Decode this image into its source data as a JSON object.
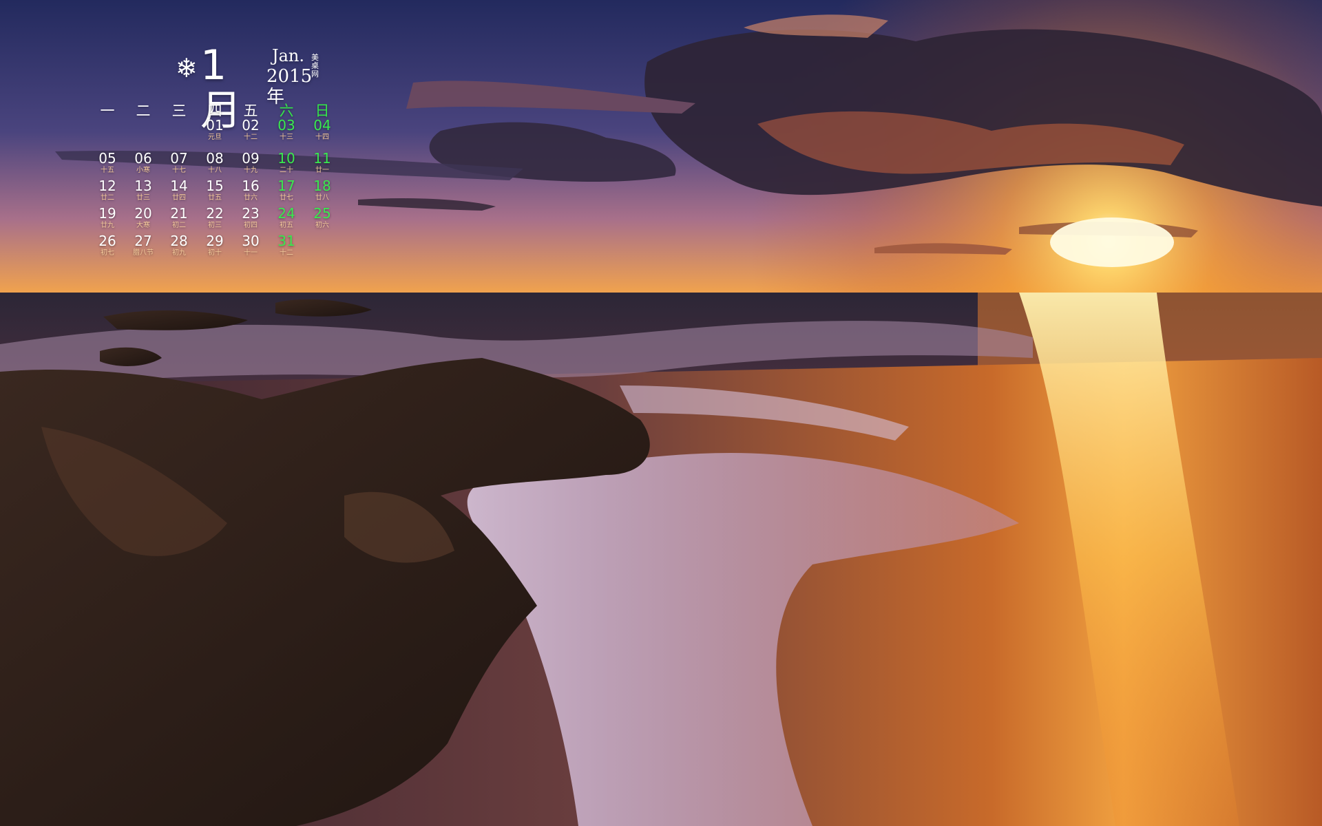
{
  "calendar": {
    "snowflake_icon": "snowflake-icon",
    "month_label": "1月",
    "month_en": "Jan.",
    "site_mark": "美桌网",
    "year_label": "2015年",
    "weekdays": [
      {
        "label": "一",
        "weekend": false
      },
      {
        "label": "二",
        "weekend": false
      },
      {
        "label": "三",
        "weekend": false
      },
      {
        "label": "四",
        "weekend": false
      },
      {
        "label": "五",
        "weekend": false
      },
      {
        "label": "六",
        "weekend": true
      },
      {
        "label": "日",
        "weekend": true
      }
    ],
    "weeks": [
      [
        null,
        null,
        null,
        {
          "num": "01",
          "lunar": "元旦"
        },
        {
          "num": "02",
          "lunar": "十二"
        },
        {
          "num": "03",
          "lunar": "十三",
          "weekend": true
        },
        {
          "num": "04",
          "lunar": "十四",
          "weekend": true
        }
      ],
      [
        {
          "num": "05",
          "lunar": "十五"
        },
        {
          "num": "06",
          "lunar": "小寒"
        },
        {
          "num": "07",
          "lunar": "十七"
        },
        {
          "num": "08",
          "lunar": "十八"
        },
        {
          "num": "09",
          "lunar": "十九"
        },
        {
          "num": "10",
          "lunar": "二十",
          "weekend": true
        },
        {
          "num": "11",
          "lunar": "廿一",
          "weekend": true
        }
      ],
      [
        {
          "num": "12",
          "lunar": "廿二"
        },
        {
          "num": "13",
          "lunar": "廿三"
        },
        {
          "num": "14",
          "lunar": "廿四"
        },
        {
          "num": "15",
          "lunar": "廿五"
        },
        {
          "num": "16",
          "lunar": "廿六"
        },
        {
          "num": "17",
          "lunar": "廿七",
          "weekend": true
        },
        {
          "num": "18",
          "lunar": "廿八",
          "weekend": true
        }
      ],
      [
        {
          "num": "19",
          "lunar": "廿九"
        },
        {
          "num": "20",
          "lunar": "大寒"
        },
        {
          "num": "21",
          "lunar": "初二"
        },
        {
          "num": "22",
          "lunar": "初三"
        },
        {
          "num": "23",
          "lunar": "初四"
        },
        {
          "num": "24",
          "lunar": "初五",
          "weekend": true
        },
        {
          "num": "25",
          "lunar": "初六",
          "weekend": true
        }
      ],
      [
        {
          "num": "26",
          "lunar": "初七"
        },
        {
          "num": "27",
          "lunar": "腊八节"
        },
        {
          "num": "28",
          "lunar": "初九"
        },
        {
          "num": "29",
          "lunar": "初十"
        },
        {
          "num": "30",
          "lunar": "十一"
        },
        {
          "num": "31",
          "lunar": "十二",
          "weekend": true
        },
        null
      ]
    ]
  },
  "colors": {
    "sky_top": "#2a2f63",
    "sky_mid": "#7a5a8e",
    "horizon": "#f0a048",
    "sun": "#fff6c8",
    "sea": "#3a2a3a",
    "sand_glow": "#e0782a",
    "rock": "#2a1d18",
    "weekend_green": "#39ea4f",
    "lunar_orange": "#f3c89a"
  }
}
